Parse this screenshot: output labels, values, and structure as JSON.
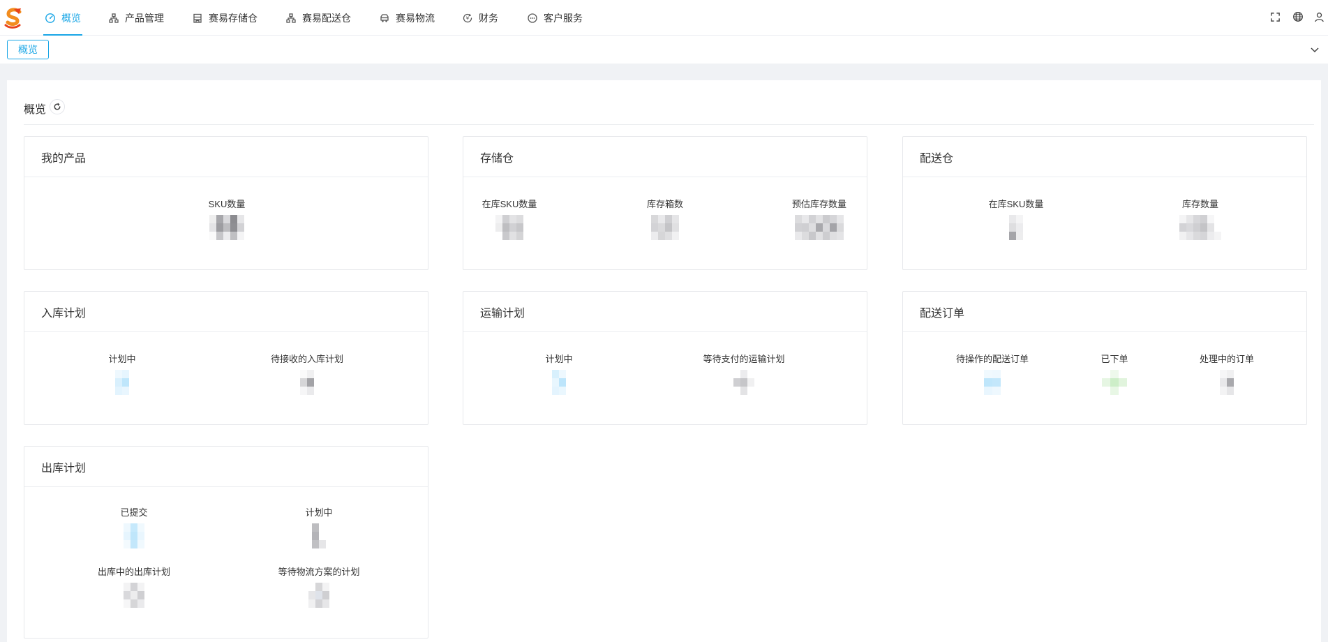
{
  "nav": {
    "items": [
      {
        "label": "概览",
        "icon": "dashboard-icon",
        "active": true
      },
      {
        "label": "产品管理",
        "icon": "sitemap-icon",
        "active": false
      },
      {
        "label": "赛易存储仓",
        "icon": "warehouse-icon",
        "active": false
      },
      {
        "label": "赛易配送仓",
        "icon": "sitemap-icon",
        "active": false
      },
      {
        "label": "赛易物流",
        "icon": "truck-icon",
        "active": false
      },
      {
        "label": "财务",
        "icon": "finance-icon",
        "active": false
      },
      {
        "label": "客户服务",
        "icon": "chat-icon",
        "active": false
      }
    ],
    "right_icons": [
      "fullscreen-icon",
      "globe-icon",
      "user-icon"
    ]
  },
  "tabs": [
    {
      "label": "概览"
    }
  ],
  "page": {
    "title": "概览"
  },
  "cards": [
    {
      "title": "我的产品",
      "stats": [
        {
          "label": "SKU数量",
          "value": ""
        }
      ]
    },
    {
      "title": "存储仓",
      "stats": [
        {
          "label": "在库SKU数量",
          "value": ""
        },
        {
          "label": "库存箱数",
          "value": ""
        },
        {
          "label": "预估库存数量",
          "value": ""
        }
      ]
    },
    {
      "title": "配送仓",
      "stats": [
        {
          "label": "在库SKU数量",
          "value": ""
        },
        {
          "label": "库存数量",
          "value": ""
        }
      ]
    },
    {
      "title": "入库计划",
      "stats": [
        {
          "label": "计划中",
          "value": ""
        },
        {
          "label": "待接收的入库计划",
          "value": ""
        }
      ]
    },
    {
      "title": "运输计划",
      "stats": [
        {
          "label": "计划中",
          "value": ""
        },
        {
          "label": "等待支付的运输计划",
          "value": ""
        }
      ]
    },
    {
      "title": "配送订单",
      "stats": [
        {
          "label": "待操作的配送订单",
          "value": ""
        },
        {
          "label": "已下单",
          "value": ""
        },
        {
          "label": "处理中的订单",
          "value": ""
        }
      ]
    },
    {
      "title": "出库计划",
      "stats": [
        {
          "label": "已提交",
          "value": ""
        },
        {
          "label": "计划中",
          "value": ""
        },
        {
          "label": "出库中的出库计划",
          "value": ""
        },
        {
          "label": "等待物流方案的计划",
          "value": ""
        }
      ]
    }
  ],
  "colors": {
    "accent": "#19a6e6",
    "blurred_neutral": "#b9b9bd",
    "blurred_blue": "#bfe6fb",
    "blurred_green": "#cdeec8"
  }
}
